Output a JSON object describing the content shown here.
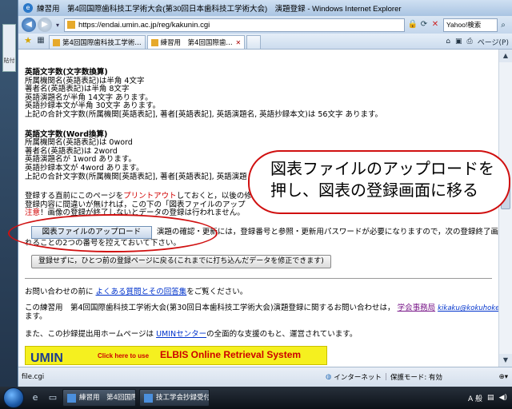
{
  "left_strip": {
    "label": "貼付"
  },
  "window": {
    "title": "練習用　第4回国際歯科技工学術大会(第30回日本歯科技工学術大会)　演題登録 - Windows Internet Explorer"
  },
  "address": {
    "url": "https://endai.umin.ac.jp/reg/kakunin.cgi",
    "search_placeholder": "Yahoo!検索"
  },
  "tabs": [
    {
      "label": "第4回国際歯科技工学術..."
    },
    {
      "label": "練習用　第4回国際歯..."
    }
  ],
  "commands": {
    "page_label": "ページ(P)"
  },
  "content": {
    "section1": {
      "heading": "英語文字数(文字数換算)",
      "lines": [
        "所属機関名(英語表記)は半角 4文字",
        "著者名(英語表記)は半角 8文字",
        "英語演題名が半角 14文字 あります。",
        "英語抄録本文が半角 30文字 あります。",
        "上記の合計文字数(所属機関[英語表記], 著者[英語表記], 英語演題名, 英語抄録本文)は 56文字 あります。"
      ]
    },
    "section2": {
      "heading": "英語文字数(Word換算)",
      "lines": [
        "所属機関名(英語表記)は 0word",
        "著者名(英語表記)は 2word",
        "英語演題名が 1word あります。",
        "英語抄録本文が 4word あります。",
        "上記の合計文字数(所属機関[英語表記], 著者[英語表記], 英語演題"
      ]
    },
    "notice": {
      "line1_pre": "登録する直前にこのページを",
      "line1_link": "プリントアウト",
      "line1_post": "しておくと，以後の修正",
      "line2": "登録内容に間違いが無ければ，この下の「図表ファイルのアップ",
      "line3_red": "注意",
      "line3_post": "！画像の登録が終了しないとデータの登録は行われません。"
    },
    "upload_button": "図表ファイルのアップロード",
    "upload_side_text": "演題の確認・更新には，登録番号と参照・更新用パスワードが必要になりますので，次の登録終了画",
    "upload_note": "れることの2つの番号を控えておいて下さい。",
    "back_button": "登録せずに，ひとつ前の登録ページに戻る(これまでに打ち込んだデータを修正できます)",
    "inquiry": {
      "pre": "お問い合わせの前に",
      "link": "よくある質問とその回答集",
      "post": "をご覧ください。"
    },
    "contact": {
      "pre": "この練習用　第4回国際歯科技工学術大会(第30回日本歯科技工学術大会)演題登録に関するお問い合わせは，",
      "link": "学会事務局",
      "email": "kikaku@kokuhoken.or.jp",
      "line2": "ます。"
    },
    "hosting": {
      "pre": "また、この抄録提出用ホームページは",
      "link": "UMINセンター",
      "post": "の全面的な支援のもと、運営されています。"
    },
    "banner": {
      "logo": "UMIN",
      "small": "Click here to use",
      "text": "ELBIS Online Retrieval System"
    }
  },
  "callout": {
    "line1": "図表ファイルのアップロードを",
    "line2": "押し、図表の登録画面に移る"
  },
  "status": {
    "url": "file.cgi",
    "zone": "インターネット",
    "protected": "保護モード: 有効"
  },
  "taskbar": {
    "tasks": [
      {
        "label": "練習用　第4回国際..."
      },
      {
        "label": "技工学会抄録受付P..."
      }
    ],
    "tray": {
      "ime": "A 般"
    }
  }
}
